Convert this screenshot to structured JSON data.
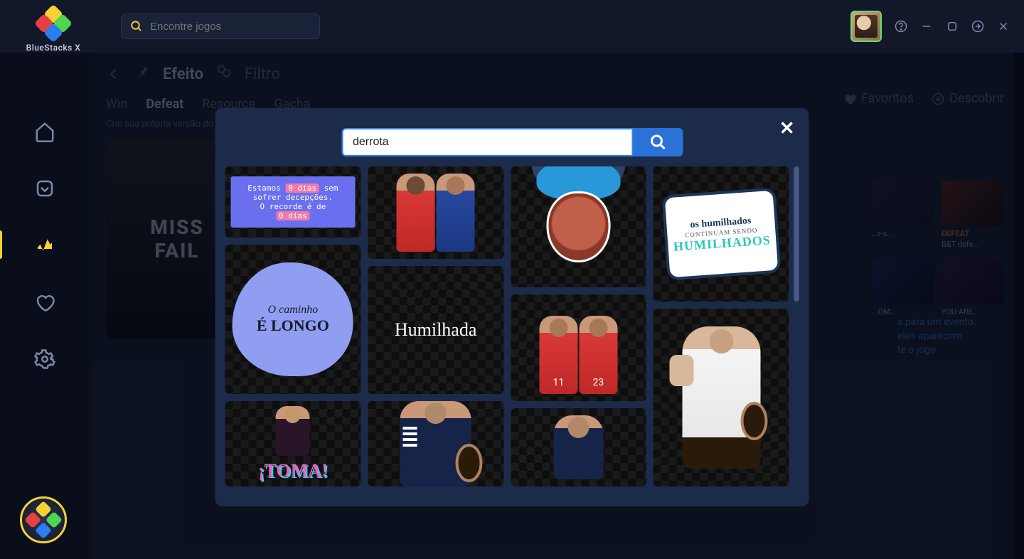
{
  "brand": "BlueStacks X",
  "search_placeholder": "Encontre jogos",
  "breadcrumb": {
    "effect": "Efeito",
    "filter": "Filtro"
  },
  "tabs": {
    "win": "Win",
    "defeat": "Defeat",
    "resource": "Resource",
    "gacha": "Gacha"
  },
  "subtitle": "Crie sua própria versão do mo",
  "right_links": {
    "favorites": "Favoritos",
    "discover": "Descobrir"
  },
  "poster": {
    "line1": "MISS",
    "line2": "FAIL"
  },
  "mini_cards": [
    {
      "caption": "...r-s..."
    },
    {
      "caption_top": "DEFEAT",
      "caption": "B&T defe..."
    },
    {
      "caption": "...OM..."
    },
    {
      "caption": "YOU ARE..."
    }
  ],
  "info_lines": [
    "s para um evento.",
    "eles aparecem",
    "te o jogo."
  ],
  "modal": {
    "search_value": "derrota",
    "gifs": {
      "txtbox_l1_a": "Estamos",
      "txtbox_hl1": "0 dias",
      "txtbox_l1_b": "sem",
      "txtbox_l2": "sofrer decepções.",
      "txtbox_l3": "O recorde é de",
      "txtbox_hl2": "0 dias",
      "cloud_l1": "O caminho",
      "cloud_l2": "É LONGO",
      "humilhada": "Humilhada",
      "sticker_l1": "os humilhados",
      "sticker_l2": "CONTINUAM SENDO",
      "sticker_l3": "HUMILHADOS",
      "jersey_red1": "11",
      "jersey_red2": "23",
      "toma": "¡TOMA!"
    }
  }
}
